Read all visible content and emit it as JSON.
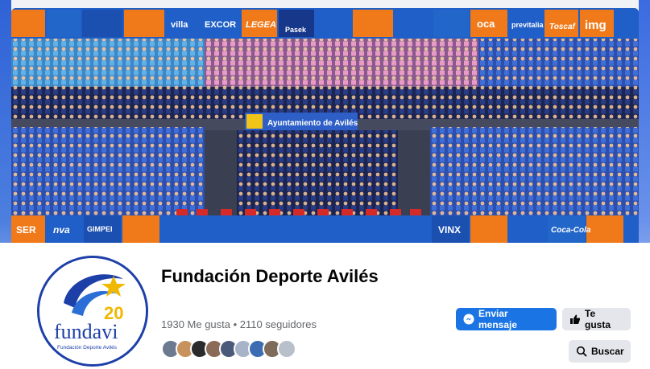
{
  "page": {
    "name": "Fundación Deporte Avilés",
    "stats": "1930 Me gusta • 2110 seguidores"
  },
  "cover": {
    "sponsors_top": [
      "villa",
      "EXCOR",
      "LEGEA",
      "Pasek",
      "oca",
      "previtalia",
      "Toscaf",
      "img"
    ],
    "sponsors_bottom": [
      "SER",
      "nva",
      "GIMPEI",
      "VINX",
      "Coca-Cola"
    ],
    "banner": "Ayuntamiento de Avilés"
  },
  "logo": {
    "text": "fundavi",
    "subtitle": "Fundación Deporte Avilés",
    "badge": "20"
  },
  "actions": {
    "message_label": "Enviar mensaje",
    "like_label": "Te gusta",
    "search_label": "Buscar"
  },
  "colors": {
    "primary_button": "#1b74e4",
    "secondary_button": "#e4e6eb",
    "text_primary": "#050505",
    "text_secondary": "#65676b"
  },
  "icons": {
    "message": "messenger-icon",
    "like": "thumbs-up-icon",
    "search": "search-icon"
  }
}
